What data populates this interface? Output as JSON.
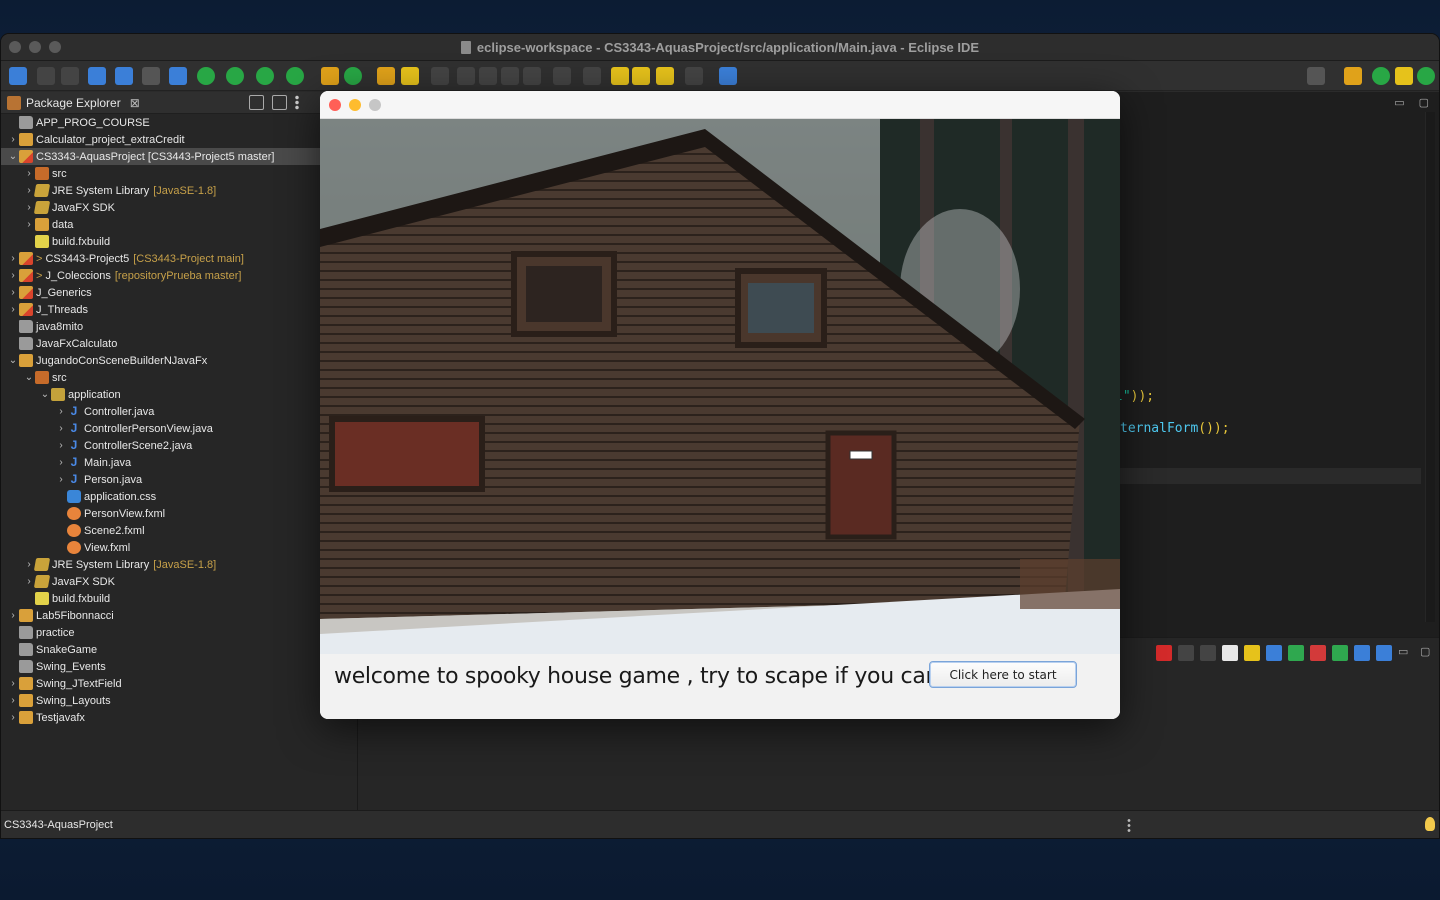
{
  "window": {
    "title": "eclipse-workspace - CS3343-AquasProject/src/application/Main.java - Eclipse IDE"
  },
  "package_explorer": {
    "tab_label": "Package Explorer",
    "close_glyph": "⊠",
    "items": [
      {
        "label": "APP_PROG_COURSE",
        "depth": 0,
        "chevron": "",
        "icon": "folder",
        "git": ""
      },
      {
        "label": "Calculator_project_extraCredit",
        "depth": 0,
        "chevron": "›",
        "icon": "proj",
        "git": ""
      },
      {
        "label": "CS3343-AquasProject [CS3443-Project5 master]",
        "depth": 0,
        "chevron": "⌄",
        "icon": "proj-git",
        "git": "",
        "selected": true
      },
      {
        "label": "src",
        "depth": 1,
        "chevron": "›",
        "icon": "pkgsrc",
        "git": ""
      },
      {
        "label": "JRE System Library",
        "depth": 1,
        "chevron": "›",
        "icon": "lib",
        "git": "[JavaSE-1.8]"
      },
      {
        "label": "JavaFX SDK",
        "depth": 1,
        "chevron": "›",
        "icon": "lib",
        "git": ""
      },
      {
        "label": "data",
        "depth": 1,
        "chevron": "›",
        "icon": "proj",
        "git": ""
      },
      {
        "label": "build.fxbuild",
        "depth": 1,
        "chevron": "",
        "icon": "build",
        "git": ""
      },
      {
        "label": "CS3443-Project5",
        "depth": 0,
        "chevron": "›",
        "icon": "proj-git",
        "git": "[CS3443-Project main]",
        "prefix": ">"
      },
      {
        "label": "J_Coleccions",
        "depth": 0,
        "chevron": "›",
        "icon": "proj-git",
        "git": "[repositoryPrueba master]",
        "prefix": ">"
      },
      {
        "label": "J_Generics",
        "depth": 0,
        "chevron": "›",
        "icon": "proj-git",
        "git": ""
      },
      {
        "label": "J_Threads",
        "depth": 0,
        "chevron": "›",
        "icon": "proj-git",
        "git": ""
      },
      {
        "label": "java8mito",
        "depth": 0,
        "chevron": "",
        "icon": "folder",
        "git": ""
      },
      {
        "label": "JavaFxCalculato",
        "depth": 0,
        "chevron": "",
        "icon": "folder",
        "git": ""
      },
      {
        "label": "JugandoConSceneBuilderNJavaFx",
        "depth": 0,
        "chevron": "⌄",
        "icon": "proj",
        "git": ""
      },
      {
        "label": "src",
        "depth": 1,
        "chevron": "⌄",
        "icon": "pkgsrc",
        "git": ""
      },
      {
        "label": "application",
        "depth": 2,
        "chevron": "⌄",
        "icon": "pkg",
        "git": ""
      },
      {
        "label": "Controller.java",
        "depth": 3,
        "chevron": "›",
        "icon": "java",
        "git": ""
      },
      {
        "label": "ControllerPersonView.java",
        "depth": 3,
        "chevron": "›",
        "icon": "java",
        "git": ""
      },
      {
        "label": "ControllerScene2.java",
        "depth": 3,
        "chevron": "›",
        "icon": "java",
        "git": ""
      },
      {
        "label": "Main.java",
        "depth": 3,
        "chevron": "›",
        "icon": "java",
        "git": ""
      },
      {
        "label": "Person.java",
        "depth": 3,
        "chevron": "›",
        "icon": "java",
        "git": ""
      },
      {
        "label": "application.css",
        "depth": 3,
        "chevron": "",
        "icon": "css",
        "git": ""
      },
      {
        "label": "PersonView.fxml",
        "depth": 3,
        "chevron": "",
        "icon": "fxml",
        "git": ""
      },
      {
        "label": "Scene2.fxml",
        "depth": 3,
        "chevron": "",
        "icon": "fxml",
        "git": ""
      },
      {
        "label": "View.fxml",
        "depth": 3,
        "chevron": "",
        "icon": "fxml",
        "git": ""
      },
      {
        "label": "JRE System Library",
        "depth": 1,
        "chevron": "›",
        "icon": "lib",
        "git": "[JavaSE-1.8]"
      },
      {
        "label": "JavaFX SDK",
        "depth": 1,
        "chevron": "›",
        "icon": "lib",
        "git": ""
      },
      {
        "label": "build.fxbuild",
        "depth": 1,
        "chevron": "",
        "icon": "build",
        "git": ""
      },
      {
        "label": "Lab5Fibonnacci",
        "depth": 0,
        "chevron": "›",
        "icon": "proj",
        "git": ""
      },
      {
        "label": "practice",
        "depth": 0,
        "chevron": "",
        "icon": "folder",
        "git": ""
      },
      {
        "label": "SnakeGame",
        "depth": 0,
        "chevron": "",
        "icon": "folder",
        "git": ""
      },
      {
        "label": "Swing_Events",
        "depth": 0,
        "chevron": "",
        "icon": "folder",
        "git": ""
      },
      {
        "label": "Swing_JTextField",
        "depth": 0,
        "chevron": "›",
        "icon": "proj",
        "git": ""
      },
      {
        "label": "Swing_Layouts",
        "depth": 0,
        "chevron": "›",
        "icon": "proj",
        "git": ""
      },
      {
        "label": "Testjavafx",
        "depth": 0,
        "chevron": "›",
        "icon": "proj",
        "git": ""
      }
    ]
  },
  "editor": {
    "code_line_1": {
      "str": "l\"",
      "rest": "));"
    },
    "code_line_2": {
      "meth": "ternalForm",
      "rest": "());"
    }
  },
  "statusbar": {
    "text": "CS3343-AquasProject"
  },
  "game": {
    "welcome_text": "welcome to spooky house game , try to scape if you can.",
    "start_button": "Click here to start"
  },
  "colors": {
    "traffic_close": "#ff5f57",
    "traffic_min": "#febc2e",
    "traffic_max": "#c6c6c6",
    "selection": "#4a4a4a",
    "git_decoration": "#c6a049"
  }
}
